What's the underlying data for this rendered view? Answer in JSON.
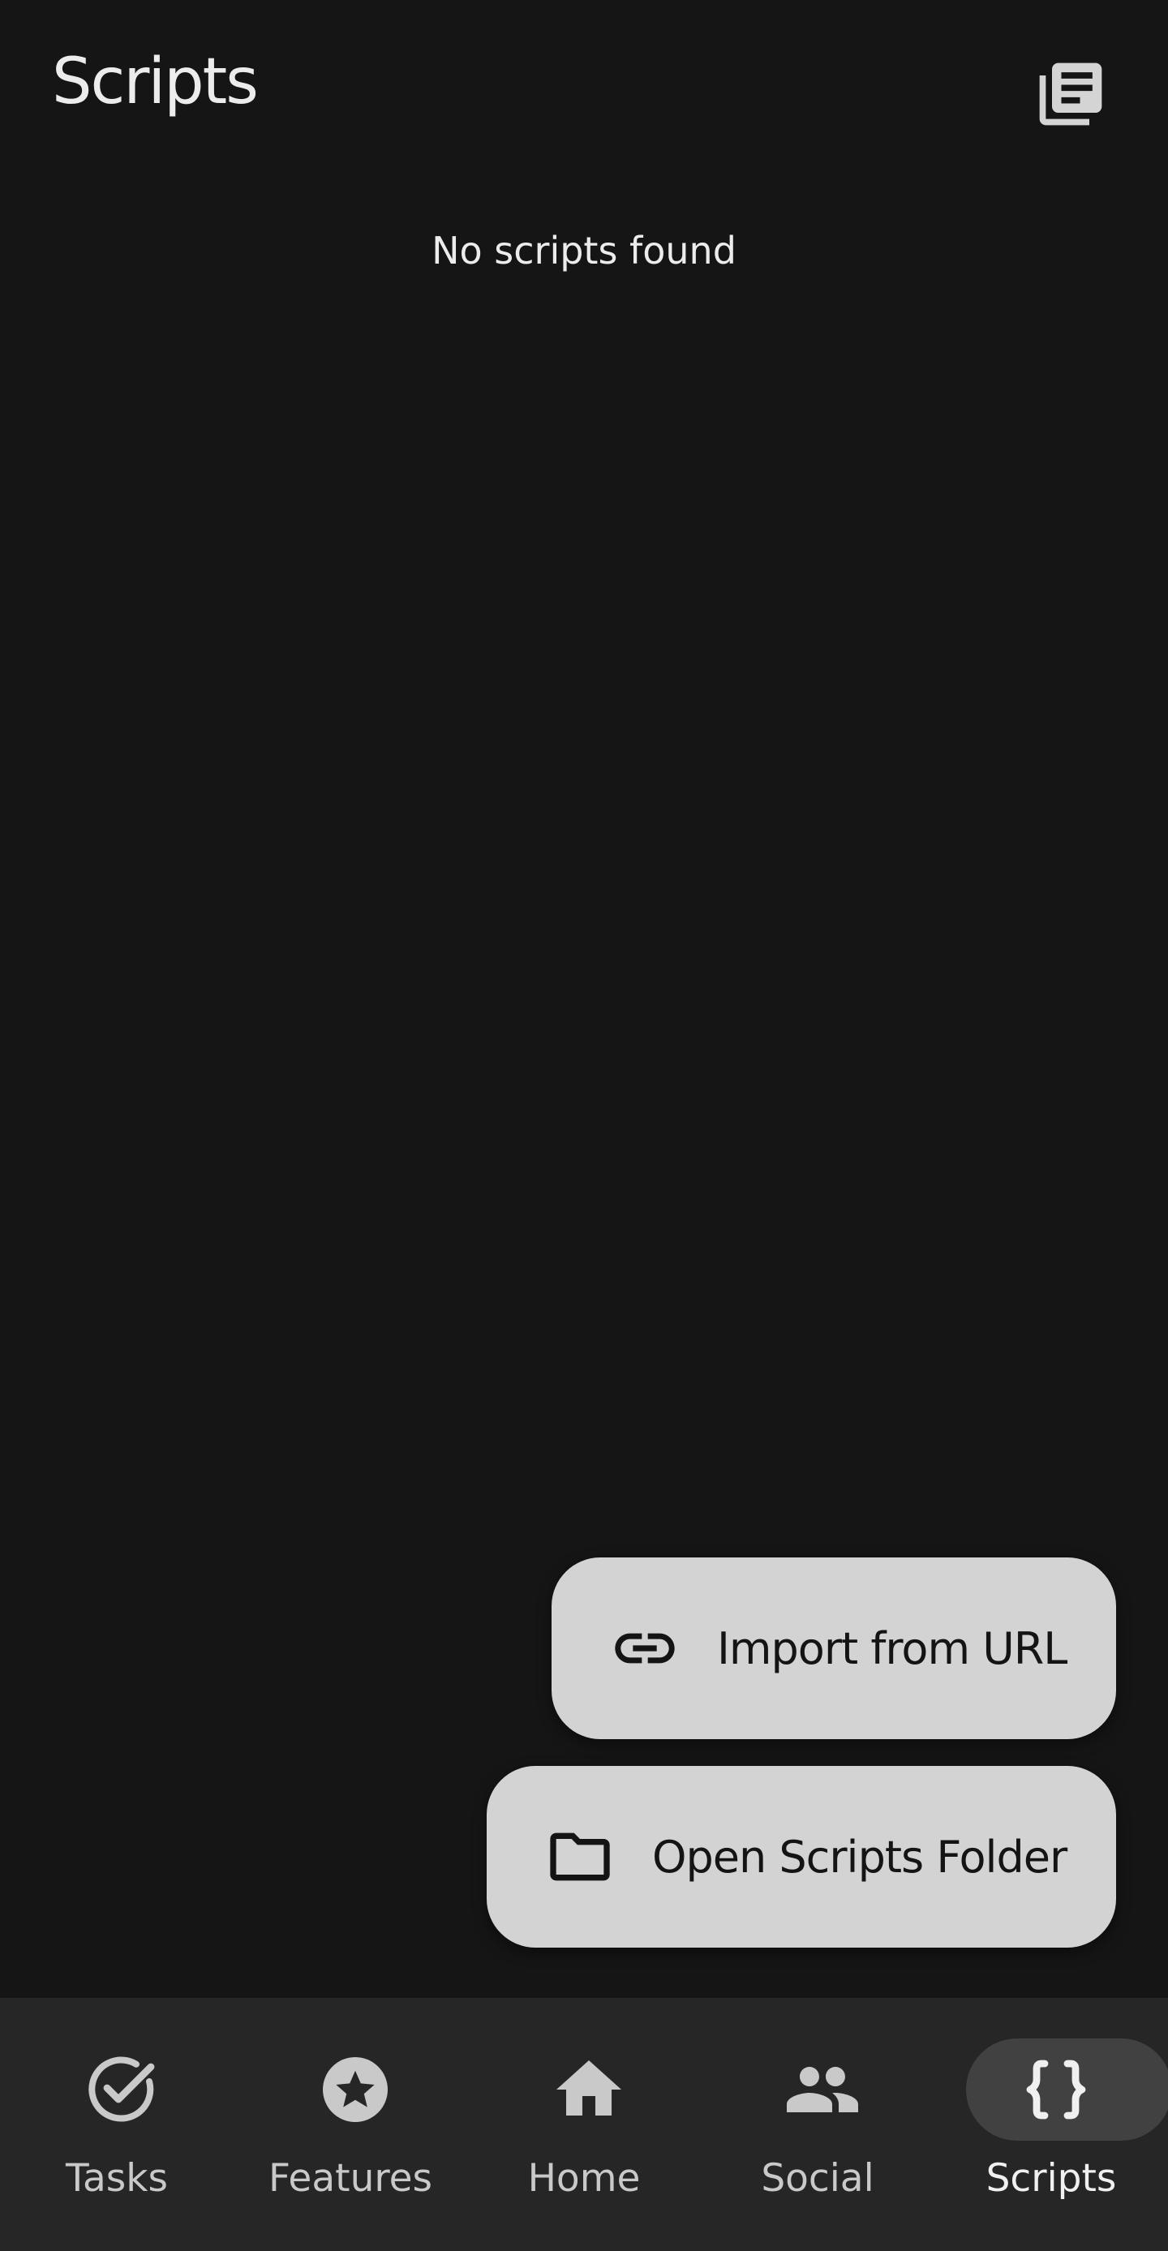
{
  "header": {
    "title": "Scripts",
    "action_icon": "library-books-icon"
  },
  "main": {
    "empty_message": "No scripts found"
  },
  "fabs": {
    "import_label": "Import from URL",
    "import_icon": "link-icon",
    "folder_label": "Open Scripts Folder",
    "folder_icon": "folder-icon"
  },
  "bottom_nav": {
    "items": [
      {
        "label": "Tasks",
        "icon": "check-circle-icon",
        "active": false
      },
      {
        "label": "Features",
        "icon": "star-circle-icon",
        "active": false
      },
      {
        "label": "Home",
        "icon": "home-icon",
        "active": false
      },
      {
        "label": "Social",
        "icon": "people-icon",
        "active": false
      },
      {
        "label": "Scripts",
        "icon": "curly-braces-icon",
        "active": true
      }
    ]
  },
  "colors": {
    "background": "#151515",
    "fab_background": "#d3d3d3",
    "nav_background": "#262626",
    "active_pill": "#414141",
    "text": "#ececec"
  }
}
